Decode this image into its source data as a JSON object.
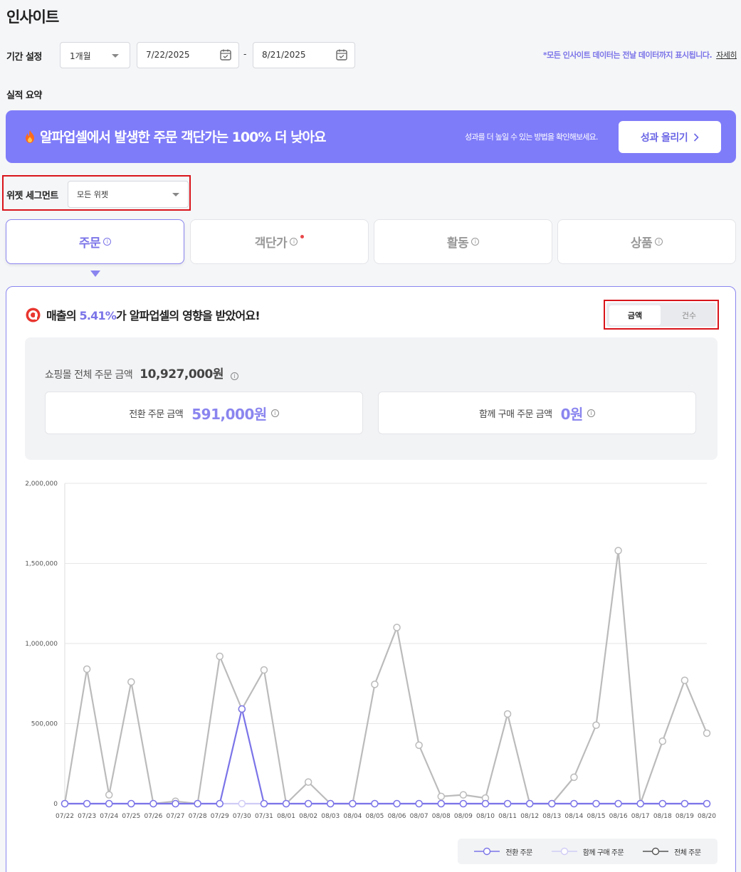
{
  "page": {
    "title": "인사이트"
  },
  "period": {
    "label": "기간 설정",
    "range_select": "1개월",
    "start_date": "7/22/2025",
    "separator": "-",
    "end_date": "8/21/2025",
    "note": "*모든 인사이트 데이터는 전날 데이터까지 표시됩니다.",
    "note_link": "자세히"
  },
  "summary": {
    "label": "실적 요약"
  },
  "banner": {
    "icon": "fire-icon",
    "title": "알파업셀에서 발생한 주문 객단가는 100% 더 낮아요",
    "subtitle": "성과를 더 높일 수 있는 방법을 확인해보세요.",
    "button": "성과 올리기"
  },
  "segment": {
    "label": "위젯 세그먼트",
    "value": "모든 위젯"
  },
  "tabs": [
    {
      "label": "주문",
      "active": true
    },
    {
      "label": "객단가",
      "active": false,
      "dot": true
    },
    {
      "label": "활동",
      "active": false
    },
    {
      "label": "상품",
      "active": false
    }
  ],
  "panel": {
    "headline_prefix": "매출의 ",
    "headline_pct": "5.41%",
    "headline_suffix": "가 알파업셀의 영향을 받았어요!",
    "toggle_on": "금액",
    "toggle_off": "건수",
    "total_label": "쇼핑몰 전체 주문 금액",
    "total_value": "10,927,000원",
    "conv_label": "전환 주문 금액",
    "conv_value": "591,000원",
    "bundle_label": "함께 구매 주문 금액",
    "bundle_value": "0원"
  },
  "colors": {
    "accent": "#7b74e8",
    "banner": "#7f7cf9",
    "series_conv": "#7b74e8",
    "series_bundle": "#d0ccf6",
    "series_total": "#bbbbbb",
    "highlight": "#d9141b"
  },
  "chart_data": {
    "type": "line",
    "x": [
      "07/22",
      "07/23",
      "07/24",
      "07/25",
      "07/26",
      "07/27",
      "07/28",
      "07/29",
      "07/30",
      "07/31",
      "08/01",
      "08/02",
      "08/03",
      "08/04",
      "08/05",
      "08/06",
      "08/07",
      "08/08",
      "08/09",
      "08/10",
      "08/11",
      "08/12",
      "08/13",
      "08/14",
      "08/15",
      "08/16",
      "08/17",
      "08/18",
      "08/19",
      "08/20"
    ],
    "yticks": [
      "0",
      "500,000",
      "1,000,000",
      "1,500,000",
      "2,000,000"
    ],
    "ylim": [
      0,
      2000000
    ],
    "series": [
      {
        "name": "전환 주문",
        "color": "#7b74e8",
        "values": [
          0,
          0,
          0,
          0,
          0,
          0,
          0,
          0,
          591000,
          0,
          0,
          0,
          0,
          0,
          0,
          0,
          0,
          0,
          0,
          0,
          0,
          0,
          0,
          0,
          0,
          0,
          0,
          0,
          0,
          0
        ]
      },
      {
        "name": "함께 구매 주문",
        "color": "#d0ccf6",
        "values": [
          0,
          0,
          0,
          0,
          0,
          0,
          0,
          0,
          0,
          0,
          0,
          0,
          0,
          0,
          0,
          0,
          0,
          0,
          0,
          0,
          0,
          0,
          0,
          0,
          0,
          0,
          0,
          0,
          0,
          0
        ]
      },
      {
        "name": "전체 주문",
        "color": "#bbbbbb",
        "values": [
          0,
          840000,
          55000,
          760000,
          0,
          15000,
          0,
          920000,
          590000,
          835000,
          0,
          135000,
          0,
          0,
          745000,
          1100000,
          365000,
          45000,
          55000,
          35000,
          560000,
          0,
          0,
          165000,
          490000,
          1580000,
          0,
          390000,
          770000,
          440000
        ]
      }
    ]
  }
}
